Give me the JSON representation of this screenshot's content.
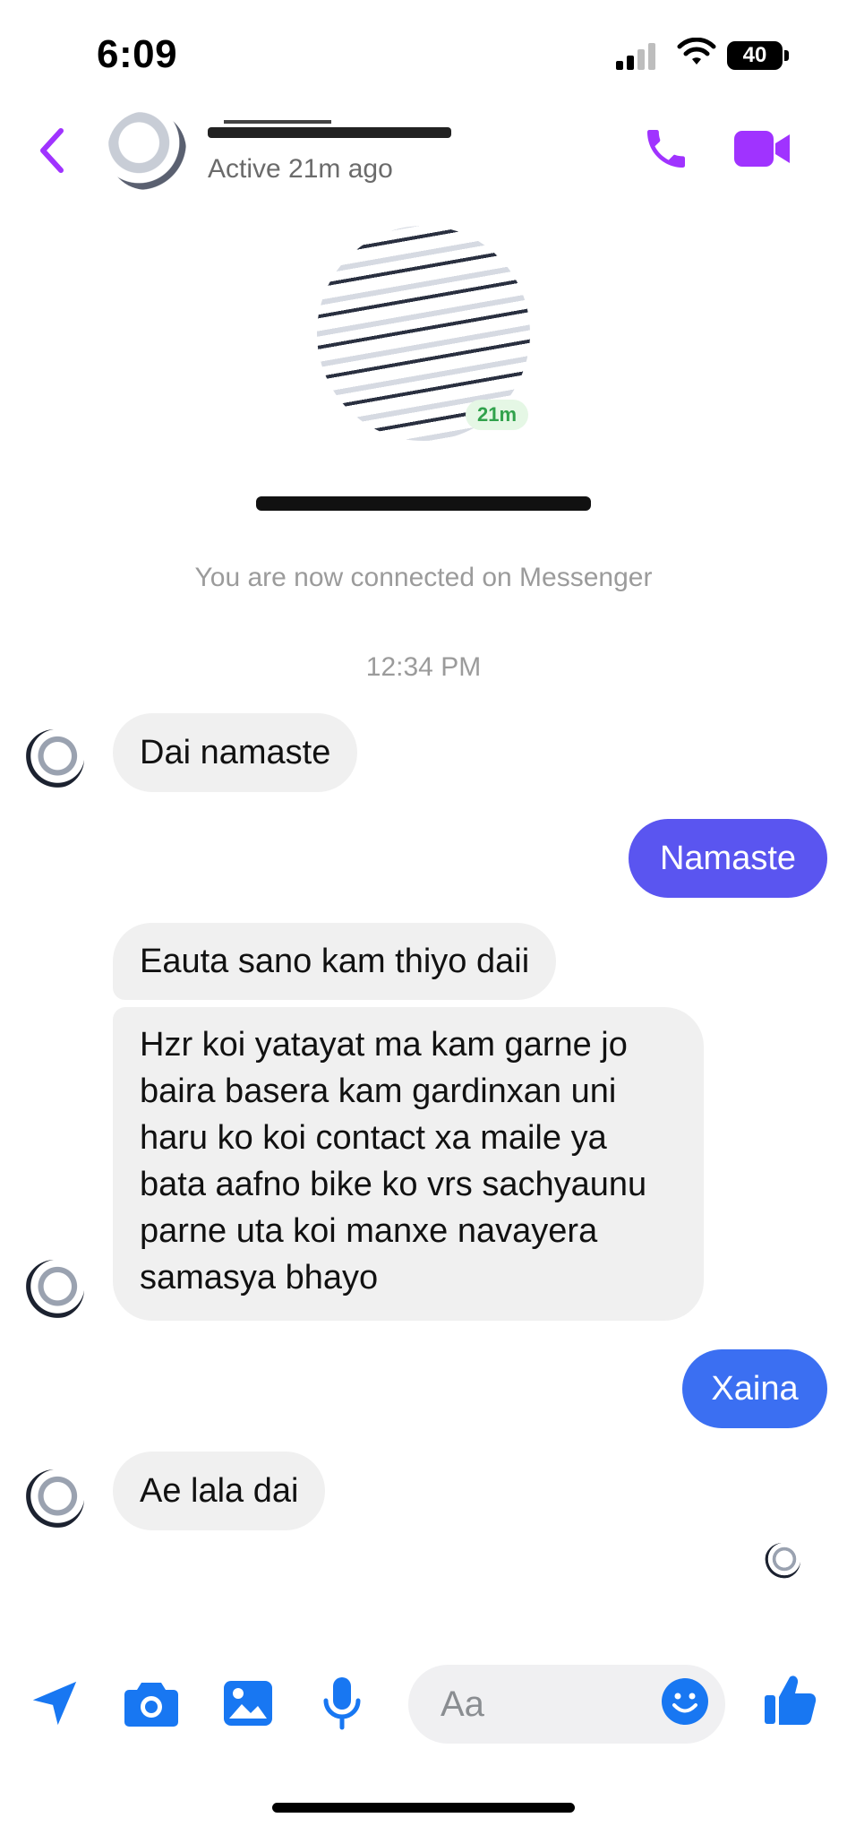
{
  "status_bar": {
    "time": "6:09",
    "battery": "40"
  },
  "header": {
    "status": "Active 21m ago"
  },
  "profile": {
    "online_badge": "21m"
  },
  "thread": {
    "connected_notice": "You are now connected on Messenger",
    "timestamp": "12:34 PM",
    "messages": [
      {
        "side": "in",
        "text": "Dai namaste"
      },
      {
        "side": "out",
        "text": "Namaste"
      },
      {
        "side": "in",
        "text": "Eauta sano kam thiyo daii"
      },
      {
        "side": "in",
        "text": "Hzr koi yatayat ma kam garne jo baira basera kam gardinxan uni haru ko koi contact xa maile ya bata aafno bike ko vrs sachyaunu parne uta koi manxe navayera samasya bhayo"
      },
      {
        "side": "out",
        "text": "Xaina"
      },
      {
        "side": "in",
        "text": "Ae lala dai"
      }
    ]
  },
  "composer": {
    "placeholder": "Aa"
  },
  "colors": {
    "accent_purple": "#a033ff",
    "bubble_out_purple": "#5a55f0",
    "bubble_out_blue": "#3b6ff2",
    "icon_blue": "#1877f2",
    "bubble_in": "#f0f0f0"
  }
}
